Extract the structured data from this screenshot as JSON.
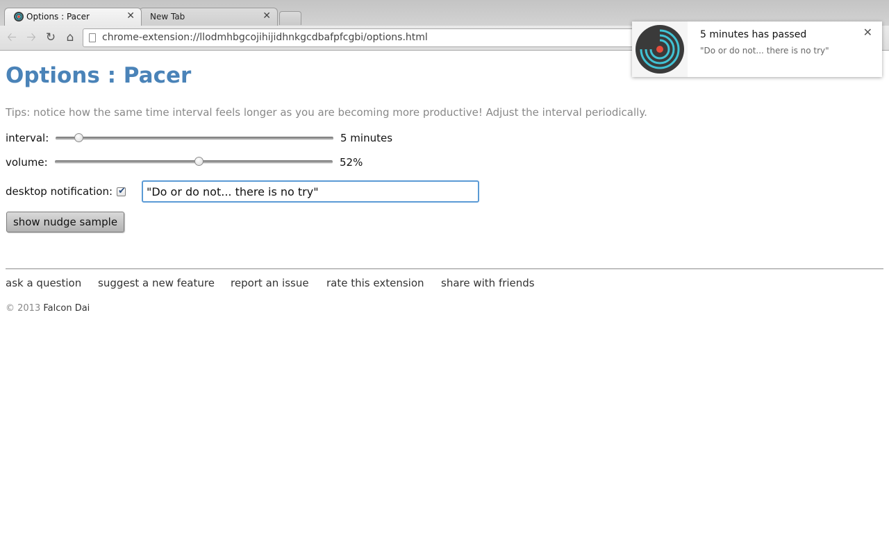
{
  "browser": {
    "tabs": [
      {
        "title": "Options : Pacer",
        "active": true
      },
      {
        "title": "New Tab",
        "active": false
      }
    ],
    "url": "chrome-extension://llodmhbgcojihijidhnkgcdbafpfcgbi/options.html"
  },
  "page": {
    "title": "Options : Pacer",
    "tips": "Tips: notice how the same time interval feels longer as you are becoming more productive! Adjust the interval periodically.",
    "interval": {
      "label": "interval:",
      "value_text": "5 minutes",
      "fraction": 0.085
    },
    "volume": {
      "label": "volume:",
      "value_text": "52%",
      "fraction": 0.52
    },
    "notification": {
      "label": "desktop notification:",
      "checked": true,
      "message": "\"Do or do not... there is no try\""
    },
    "nudge_button": "show nudge sample"
  },
  "footer": {
    "links": [
      "ask a question",
      "suggest a new feature",
      "report an issue",
      "rate this extension",
      "share with friends"
    ],
    "copyright_prefix": "© 2013",
    "author": "Falcon Dai"
  },
  "desktop_notification": {
    "title": "5 minutes has passed",
    "body": "\"Do or do not... there is no try\"",
    "icon": "pacer-logo-icon"
  },
  "colors": {
    "title": "#4a83b8",
    "tips": "#888888",
    "focus_border": "#5a9ad5",
    "logo_ring": "#41c2d4",
    "logo_center": "#e74c3c"
  }
}
